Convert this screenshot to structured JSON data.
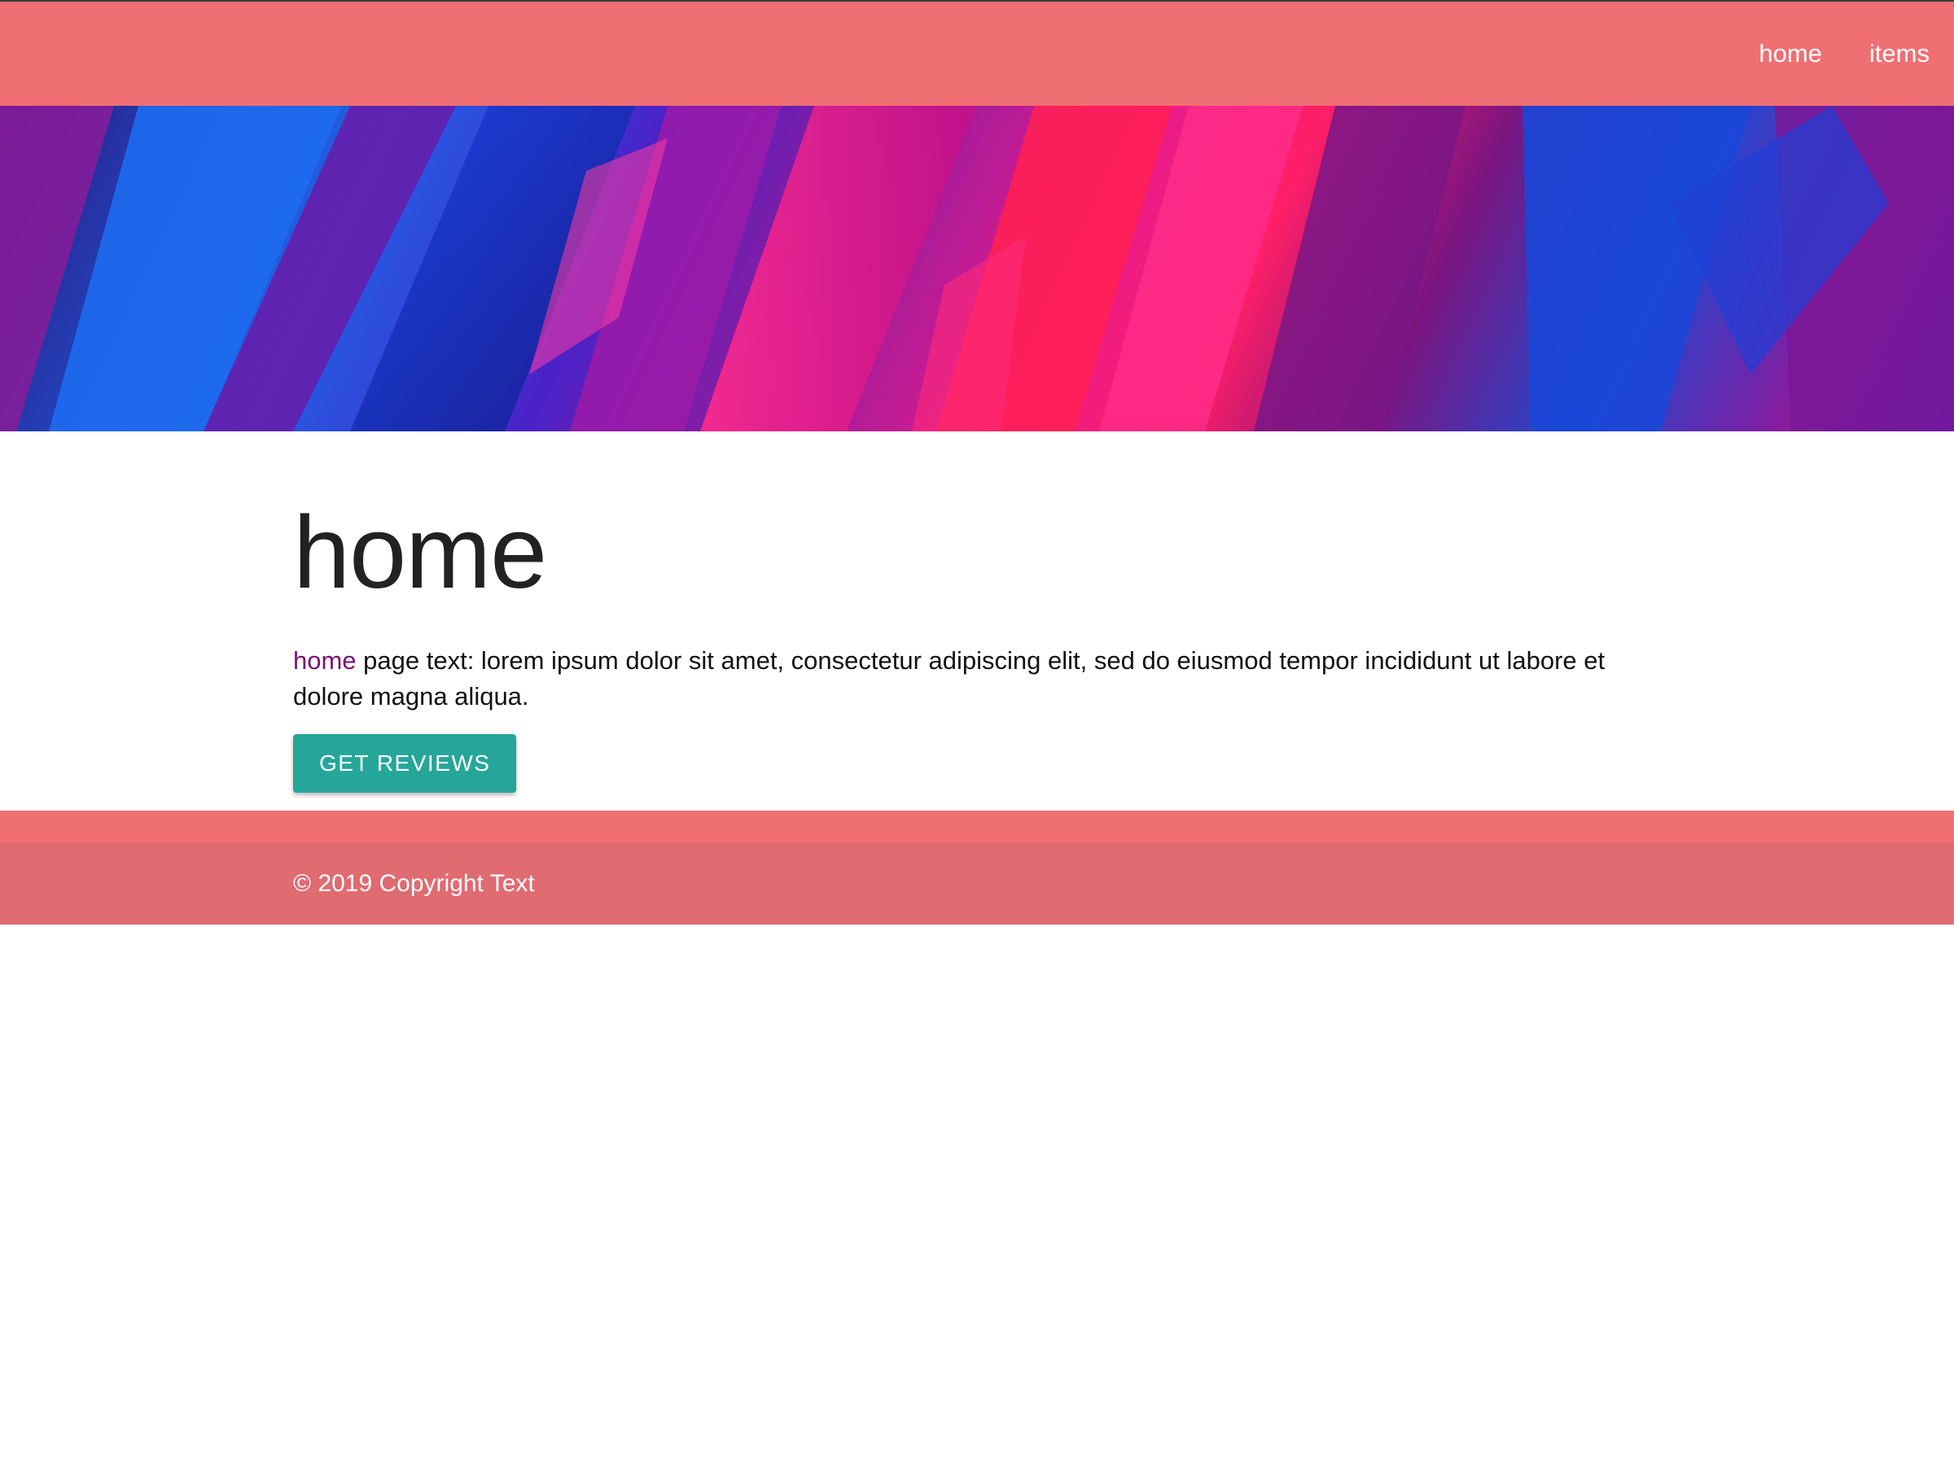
{
  "navbar": {
    "links": [
      {
        "label": "home"
      },
      {
        "label": "items"
      }
    ],
    "background": "#ef6f73"
  },
  "banner": {
    "description": "abstract paint image"
  },
  "main": {
    "title": "home",
    "text_link": "home",
    "text_body": " page text: lorem ipsum dolor sit amet, consectetur adipiscing elit, sed do eiusmod tempor incididunt ut labore et dolore magna aliqua.",
    "button_label": "GET REVIEWS",
    "button_color": "#26a69a"
  },
  "footer": {
    "copyright": "© 2019 Copyright Text",
    "background": "#e06b71"
  }
}
